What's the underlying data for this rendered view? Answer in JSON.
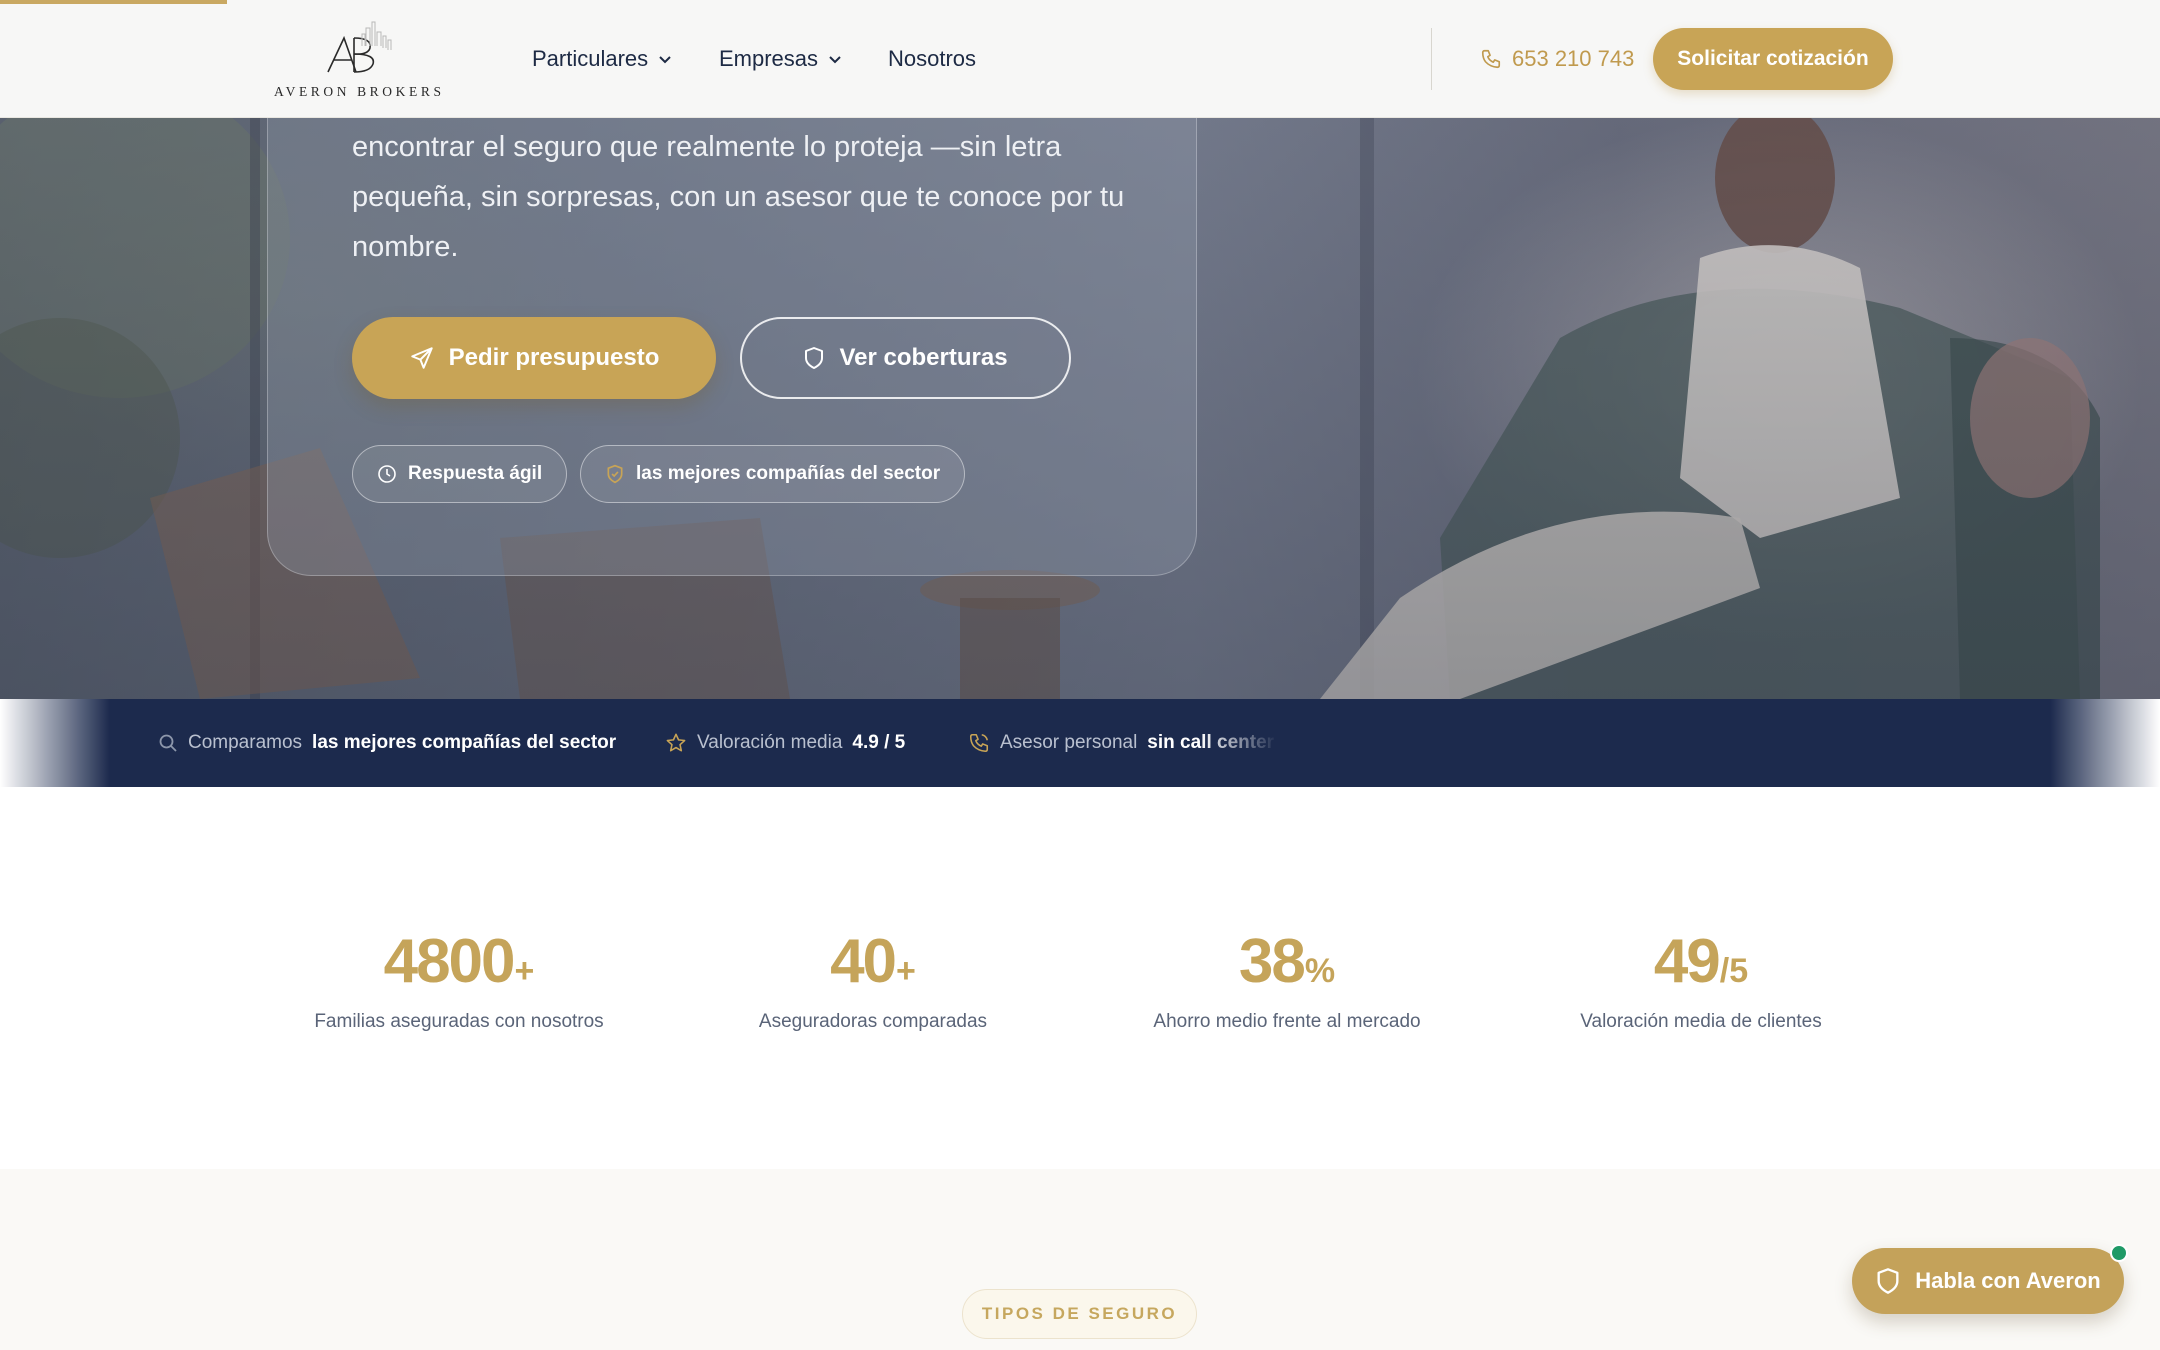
{
  "header": {
    "brand_name": "AVERON BROKERS",
    "nav": [
      {
        "label": "Particulares",
        "dropdown": true
      },
      {
        "label": "Empresas",
        "dropdown": true
      },
      {
        "label": "Nosotros",
        "dropdown": false
      }
    ],
    "phone": "653 210 743",
    "cta_label": "Solicitar cotización"
  },
  "hero": {
    "text_lines": [
      "encontrar el seguro que realmente lo proteja —sin letra",
      "pequeña, sin sorpresas, con un asesor que te conoce por tu",
      "nombre."
    ],
    "primary_button": "Pedir presupuesto",
    "secondary_button": "Ver coberturas",
    "chips": [
      {
        "label": "Respuesta ágil",
        "icon": "clock-icon"
      },
      {
        "label": "las mejores compañías del sector",
        "icon": "shield-check-icon"
      }
    ]
  },
  "ticker": {
    "items": [
      {
        "icon": "search-icon",
        "prefix": "Comparamos",
        "strong": "las mejores compañías del sector"
      },
      {
        "icon": "star-icon",
        "prefix": "Valoración media",
        "strong": "4.9 / 5"
      },
      {
        "icon": "phone-call-icon",
        "prefix": "Asesor personal",
        "strong": "sin call center"
      }
    ]
  },
  "stats": [
    {
      "number": "4800",
      "suffix": "+",
      "label": "Familias aseguradas con nosotros"
    },
    {
      "number": "40",
      "suffix": "+",
      "label": "Aseguradoras comparadas"
    },
    {
      "number": "38",
      "suffix": "%",
      "label": "Ahorro medio frente al mercado"
    },
    {
      "number": "49",
      "suffix": "/5",
      "label": "Valoración media de clientes"
    }
  ],
  "section_badge": "TIPOS DE SEGURO",
  "chat": {
    "label": "Habla con Averon",
    "online": true
  },
  "colors": {
    "gold": "#c8a456",
    "navy": "#1c2a4d",
    "text": "#1d2a44",
    "online": "#1f9a66"
  }
}
